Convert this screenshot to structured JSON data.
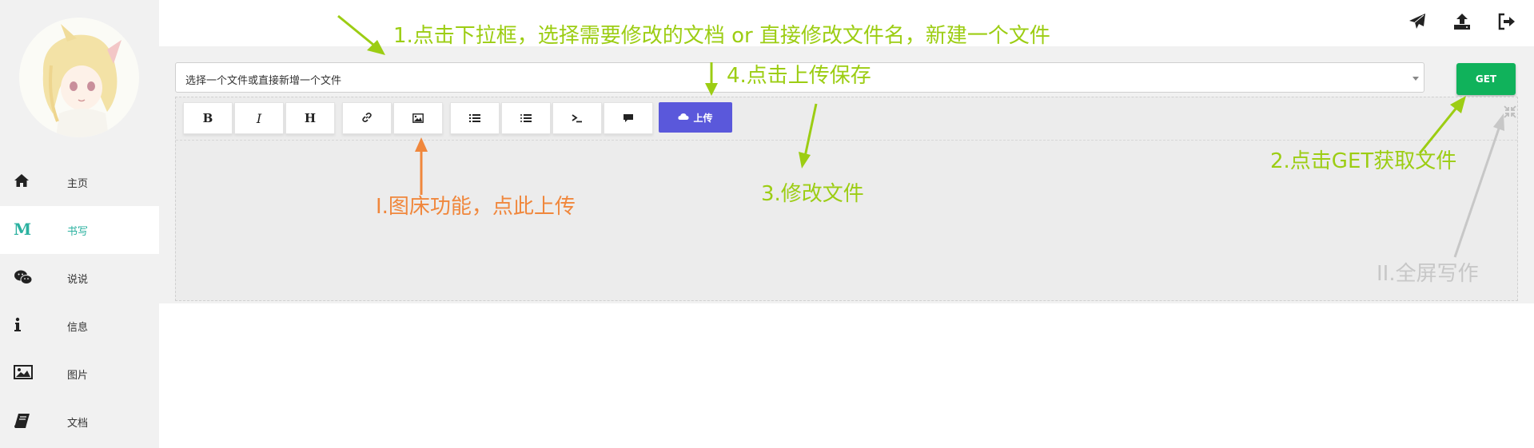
{
  "sidebar": {
    "items": [
      {
        "label": "主页",
        "icon": "home-icon"
      },
      {
        "label": "书写",
        "icon": "markdown-icon",
        "active": true
      },
      {
        "label": "说说",
        "icon": "wechat-icon"
      },
      {
        "label": "信息",
        "icon": "info-icon"
      },
      {
        "label": "图片",
        "icon": "image-icon"
      },
      {
        "label": "文档",
        "icon": "book-icon"
      }
    ]
  },
  "topbar": {
    "icons": [
      "send-icon",
      "upload-icon",
      "logout-icon"
    ]
  },
  "editor": {
    "file_select_placeholder": "选择一个文件或直接新增一个文件",
    "get_label": "GET",
    "upload_label": "上传",
    "toolbar": {
      "bold": "B",
      "italic": "I",
      "heading": "H",
      "icons": [
        "link-icon",
        "image-icon",
        "ordered-list-icon",
        "unordered-list-icon",
        "code-icon",
        "quote-icon"
      ]
    }
  },
  "annotations": {
    "step1": "1.点击下拉框，选择需要修改的文档 or 直接修改文件名，新建一个文件",
    "step2": "2.点击GET获取文件",
    "step3": "3.修改文件",
    "step4": "4.点击上传保存",
    "tip1": "I.图床功能，点此上传",
    "tip2": "II.全屏写作"
  },
  "colors": {
    "accent_teal": "#2bb1a0",
    "get_green": "#10b25b",
    "upload_purple": "#5a58db",
    "annotation_green": "#9ccd13",
    "annotation_orange": "#f0873c",
    "annotation_gray": "#c7c7c7"
  }
}
